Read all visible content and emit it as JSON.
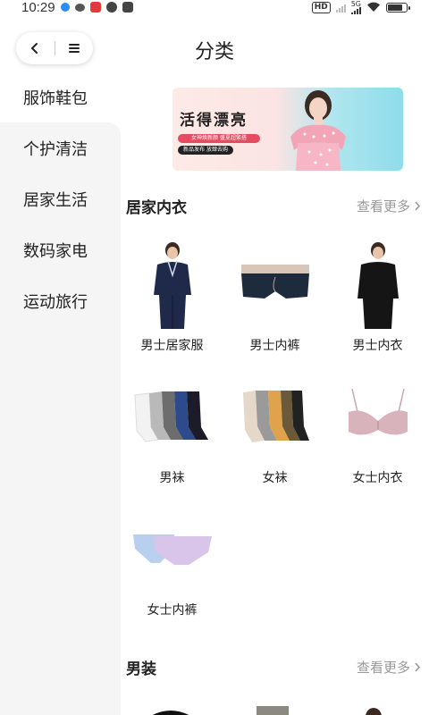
{
  "status_bar": {
    "time": "10:29",
    "hd_label": "HD",
    "network": "5G"
  },
  "header": {
    "title": "分类"
  },
  "sidebar": {
    "items": [
      {
        "label": "服饰鞋包",
        "active": true
      },
      {
        "label": "个护清洁",
        "active": false
      },
      {
        "label": "居家生活",
        "active": false
      },
      {
        "label": "数码家电",
        "active": false
      },
      {
        "label": "运动旅行",
        "active": false
      }
    ]
  },
  "banner": {
    "title": "活得漂亮",
    "line1": "女神焕新颜 盛夏超繁搭",
    "line2": "新品发布 放肆去购"
  },
  "sections": [
    {
      "title": "居家内衣",
      "more": "查看更多",
      "products": [
        {
          "name": "男士居家服",
          "icon": "mens-loungewear"
        },
        {
          "name": "男士内裤",
          "icon": "mens-underpants"
        },
        {
          "name": "男士内衣",
          "icon": "mens-undershirt"
        },
        {
          "name": "男袜",
          "icon": "mens-socks"
        },
        {
          "name": "女袜",
          "icon": "womens-socks"
        },
        {
          "name": "女士内衣",
          "icon": "bra"
        },
        {
          "name": "女士内裤",
          "icon": "womens-underpants"
        }
      ]
    },
    {
      "title": "男装",
      "more": "查看更多"
    }
  ],
  "colors": {
    "accent": "#ffd77a",
    "sidebar_bg": "#f5f5f5",
    "banner_red": "#e54b61"
  }
}
